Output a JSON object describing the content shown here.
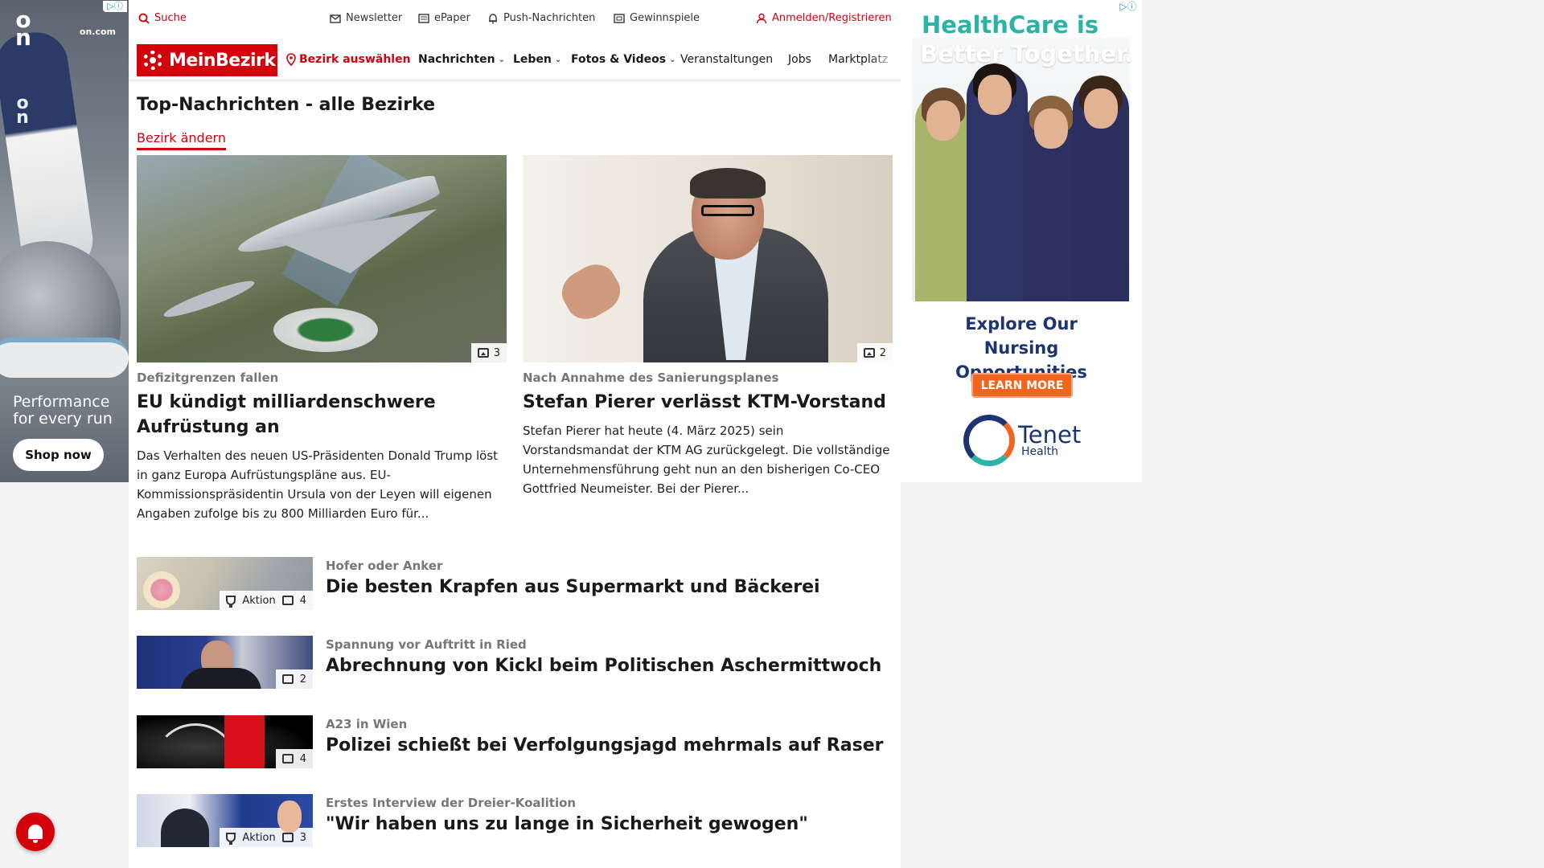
{
  "ads": {
    "left": {
      "domain": "on.com",
      "tagline": "Performance for every run",
      "cta": "Shop now",
      "choice": "▷ⓘ"
    },
    "right": {
      "choice": "▷ⓘ",
      "headline_line1": "HealthCare is",
      "headline_line2": "Better Together.",
      "body": "Explore Our Nursing Opportunities",
      "cta": "LEARN MORE",
      "brand": "Tenet",
      "brand_sub": "Health"
    }
  },
  "utility_bar": {
    "search": "Suche",
    "newsletter": "Newsletter",
    "epaper": "ePaper",
    "push": "Push-Nachrichten",
    "contests": "Gewinnspiele",
    "login": "Anmelden/Registrieren"
  },
  "nav": {
    "brand": "MeinBezirk",
    "select_district": "Bezirk auswählen",
    "items": [
      "Nachrichten",
      "Leben",
      "Fotos & Videos",
      "Veranstaltungen",
      "Jobs",
      "Marktplatz"
    ]
  },
  "page": {
    "title": "Top-Nachrichten - alle Bezirke",
    "change_district": "Bezirk ändern"
  },
  "featured": [
    {
      "kicker": "Defizitgrenzen fallen",
      "headline": "EU kündigt milliardenschwere Aufrüstung an",
      "teaser": "Das Verhalten des neuen US-Präsidenten Donald Trump löst in ganz Europa Aufrüstungspläne aus. EU-Kommissionspräsidentin Ursula von der Leyen will eigenen Angaben zufolge bis zu 800 Milliarden Euro für...",
      "image_count": "3"
    },
    {
      "kicker": "Nach Annahme des Sanierungsplanes",
      "headline": "Stefan Pierer verlässt KTM-Vorstand",
      "teaser": "Stefan Pierer hat heute (4. März 2025) sein Vorstandsmandat der KTM AG zurückgelegt. Die vollständige Unternehmensführung geht nun an den bisherigen Co-CEO Gottfried Neumeister. Bei der Pierer...",
      "image_count": "2"
    }
  ],
  "articles": [
    {
      "kicker": "Hofer oder Anker",
      "title": "Die besten Krapfen aus Supermarkt und Bäckerei",
      "badge": "Aktion",
      "image_count": "4"
    },
    {
      "kicker": "Spannung vor Auftritt in Ried",
      "title": "Abrechnung von Kickl beim Politischen Aschermittwoch",
      "badge": "",
      "image_count": "2"
    },
    {
      "kicker": "A23 in Wien",
      "title": "Polizei schießt bei Verfolgungsjagd mehrmals auf Raser",
      "badge": "",
      "image_count": "4"
    },
    {
      "kicker": "Erstes Interview der Dreier-Koalition",
      "title": "\"Wir haben uns zu lange in Sicherheit gewogen\"",
      "badge": "Aktion",
      "image_count": "3"
    }
  ],
  "colors": {
    "brand_red": "#d4000c",
    "teal": "#2ab3a6",
    "navy": "#1c3472",
    "orange": "#f0661f"
  }
}
